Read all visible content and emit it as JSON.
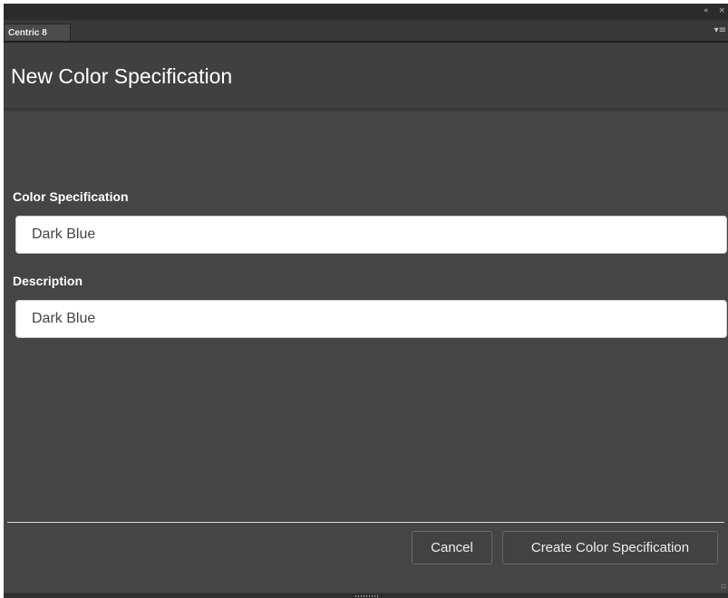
{
  "window": {
    "collapse_icon": "double-chevron-left-icon",
    "collapse_glyph": "«",
    "close_icon": "close-icon",
    "close_glyph": "×"
  },
  "tabbar": {
    "tab_label": "Centric 8",
    "menu_icon": "panel-menu-icon",
    "menu_glyph": "▾≡"
  },
  "header": {
    "title": "New Color Specification"
  },
  "form": {
    "color_spec": {
      "label": "Color Specification",
      "value": "Dark Blue"
    },
    "description": {
      "label": "Description",
      "value": "Dark Blue"
    }
  },
  "footer": {
    "cancel_label": "Cancel",
    "create_label": "Create Color Specification"
  },
  "colors": {
    "panel_bg": "#454545",
    "header_bg": "#404040",
    "titlebar_bg": "#2b2b2b",
    "input_bg": "#ffffff",
    "text": "#ffffff"
  }
}
